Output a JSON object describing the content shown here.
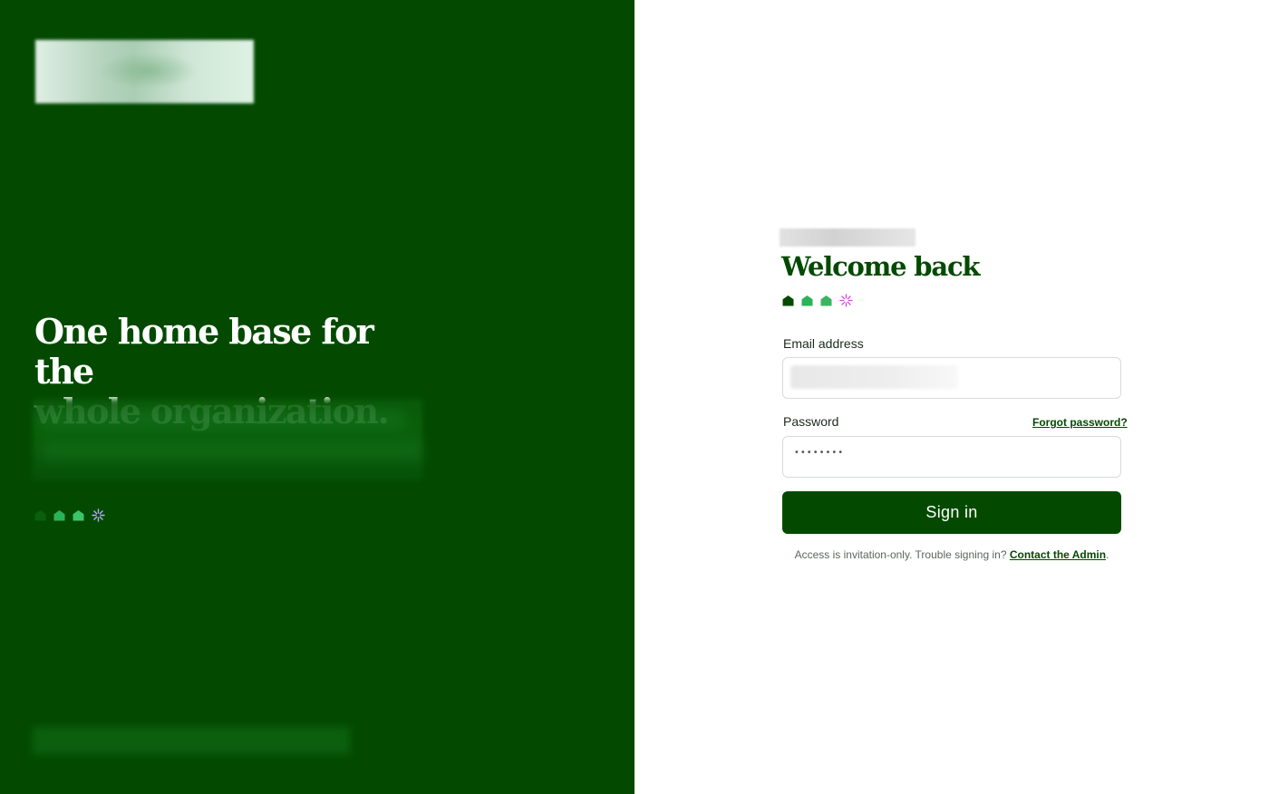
{
  "hero": {
    "title_line1": "One home base for the",
    "title_line2": "whole organization."
  },
  "brand": {
    "primary_color": "#034a00",
    "icons": [
      "house-dark-icon",
      "house-icon",
      "house-icon",
      "sparkle-icon"
    ]
  },
  "login": {
    "heading": "Welcome back",
    "email_label": "Email address",
    "password_label": "Password",
    "forgot_link": "Forgot password?",
    "password_value": "••••••••",
    "signin_label": "Sign in",
    "help_prefix": "Access is invitation-only. Trouble signing in?",
    "help_link": "Contact the Admin",
    "help_suffix": "."
  }
}
